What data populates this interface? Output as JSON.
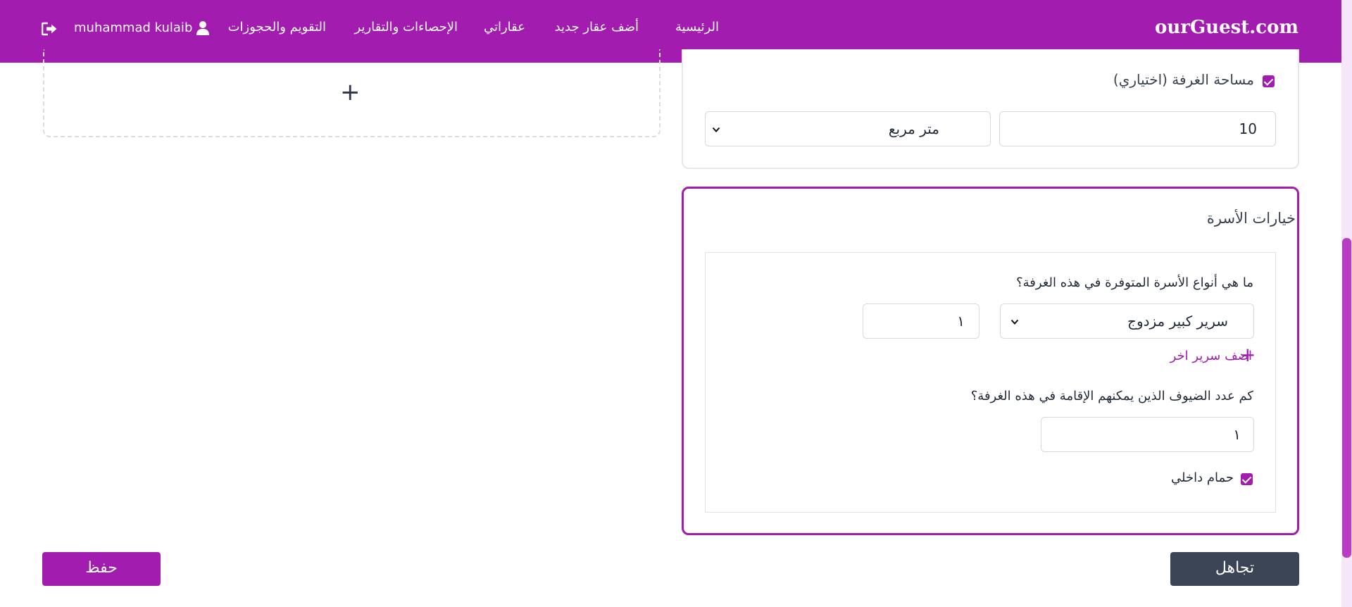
{
  "header": {
    "brand": "ourGuest.com",
    "nav": [
      "الرئيسية",
      "أضف عقار جديد",
      "عقاراتي",
      "الإحصاءات والتقارير",
      "التقويم والحجوزات"
    ],
    "user_name": "muhammad kulaib",
    "user_icon": "user-icon",
    "logout_icon": "logout-icon"
  },
  "upload": {
    "add_symbol": "+"
  },
  "room_size": {
    "checkbox_label": "مساحة الغرفة (اختياري)",
    "checked": true,
    "value": "10",
    "unit": "متر مربع"
  },
  "bed_options": {
    "title": "خيارات الأسرة",
    "bed_types_question": "ما هي أنواع الأسرة المتوفرة في هذه الغرفة؟",
    "bed_type": "سرير كبير مزدوج",
    "bed_count": "١",
    "add_bed_label": "اضف سرير اخر",
    "guests_question": "كم عدد الضيوف الذين يمكنهم الإقامة في هذه الغرفة؟",
    "guests_count": "١",
    "private_bathroom_label": "حمام داخلي",
    "private_bathroom_checked": true
  },
  "buttons": {
    "save": "حفظ",
    "skip": "تجاهل"
  },
  "colors": {
    "primary": "#a21caf",
    "dark_button": "#3b4556"
  }
}
